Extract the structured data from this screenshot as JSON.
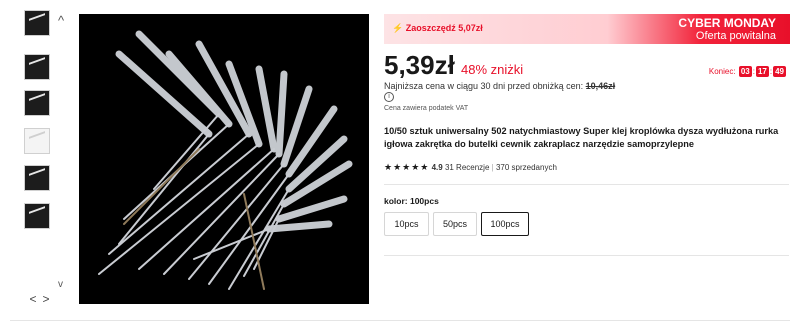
{
  "gallery": {
    "up_arrow": "^",
    "down_arrow": "v",
    "prev": "<",
    "next": ">"
  },
  "banner": {
    "savings": "Zaoszczędź 5,07zł",
    "title": "CYBER MONDAY",
    "subtitle": "Oferta powitalna"
  },
  "price": {
    "current": "5,39zł",
    "discount": "48% zniżki",
    "countdown_label": "Koniec:",
    "hours": "03",
    "minutes": "17",
    "seconds": "49",
    "lowest_text": "Najniższa cena w ciągu 30 dni przed obniżką cen:",
    "lowest_value": "10,46zł",
    "info_glyph": "i",
    "vat": "Cena zawiera podatek VAT"
  },
  "product": {
    "title": "10/50 sztuk uniwersalny 502 natychmiastowy Super klej kroplówka dysza wydłużona rurka igłowa zakrętka do butelki cewnik zakraplacz narzędzie samoprzylepne",
    "stars": "★★★★★",
    "rating": "4.9",
    "reviews": "31 Recenzje",
    "separator": "|",
    "sold": "370 sprzedanych"
  },
  "variant": {
    "label": "kolor: 100pcs",
    "options": [
      "10pcs",
      "50pcs",
      "100pcs"
    ],
    "selected": "100pcs"
  },
  "colors": {
    "accent": "#e8102a",
    "text": "#191919"
  }
}
